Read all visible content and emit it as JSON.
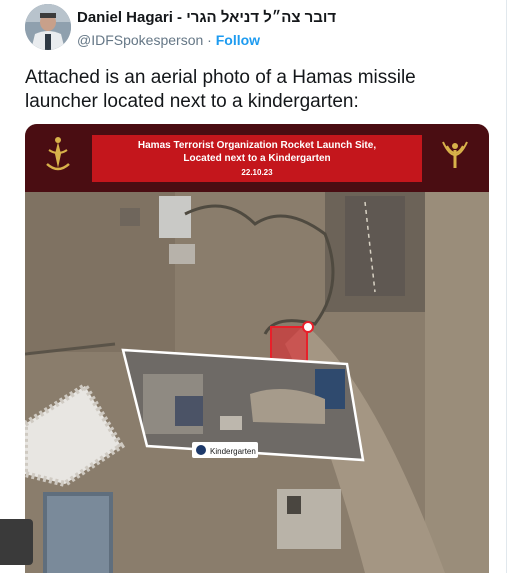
{
  "author": {
    "name": "Daniel Hagari - דובר צה״ל דניאל הגרי",
    "handle": "@IDFSpokesperson",
    "separator": "·",
    "follow_label": "Follow"
  },
  "tweet": {
    "text": "Attached is an aerial photo of a Hamas missile launcher located next to a kindergarten:"
  },
  "media": {
    "banner_title_line1": "Hamas Terrorist Organization Rocket Launch Site,",
    "banner_title_line2": "Located next to a Kindergarten",
    "banner_date": "22.10.23",
    "kindergarten_label": "Kindergarten",
    "banner_color": "#c4161c",
    "header_bg": "#4a0d12",
    "marker_color": "#e8202a"
  }
}
